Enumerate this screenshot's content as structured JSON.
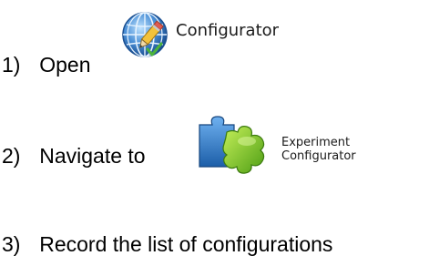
{
  "steps": [
    {
      "number": "1)",
      "text": "Open"
    },
    {
      "number": "2)",
      "text": "Navigate to"
    },
    {
      "number": "3)",
      "text": "Record the list of configurations"
    }
  ],
  "configurator": {
    "icon": "globe-pencil-icon",
    "label": "Configurator"
  },
  "experiment_configurator": {
    "icon": "puzzle-pieces-icon",
    "label_line1": "Experiment",
    "label_line2": "Configurator"
  },
  "colors": {
    "text": "#000000",
    "globe_blue": "#2f6fb8",
    "puzzle_blue": "#2a78c8",
    "puzzle_green": "#7cc72a"
  }
}
